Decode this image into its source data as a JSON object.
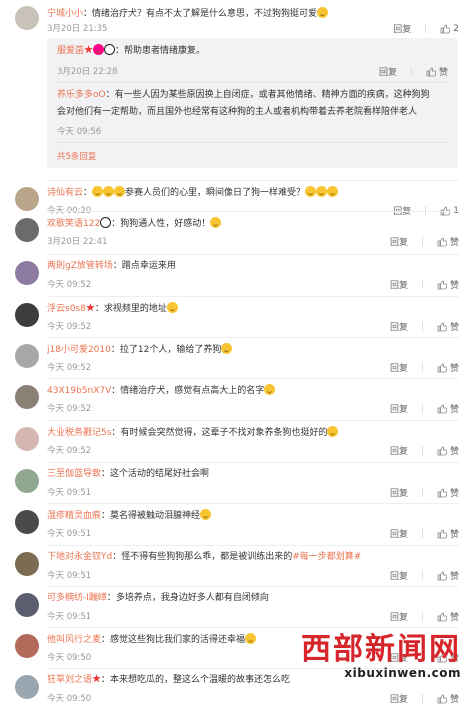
{
  "colors": {
    "nickname": "#eb7350",
    "watermark": "#d7262b",
    "panel": "#f2f2f5"
  },
  "icons": {
    "like": "thumb-up-icon"
  },
  "top_comment": {
    "user": "宁城小小",
    "text": "情绪治疗犬？有点不太了解是什么意思，不过狗狗挺可爱",
    "time": "3月20日 21:35",
    "reply": "回复",
    "likes": "2"
  },
  "replies": [
    {
      "user": "服爱菡",
      "text": "帮助患者情绪康复。",
      "time": "3月20日 22:28",
      "reply": "回复",
      "like": "赞"
    },
    {
      "user": "养乐多多oO",
      "text": "有一些人因为某些原因换上自闭症，或者其他情绪、精神方面的疾病，这种狗狗",
      "text2": "会对他们有一定帮助，而且国外也经常有这种狗的主人或者机构带着去养老院看样陪伴老人",
      "time": "今天 09:56",
      "reply": "回复",
      "like": "赞"
    }
  ],
  "more_replies": "共5条回复",
  "comments": [
    {
      "user": "诗仙有云",
      "text": "参赛人员们的心里，瞬间像日了狗一样难受？",
      "time": "今天 00:20",
      "reply": "回复",
      "likes": "1"
    },
    {
      "user": "欢歌笑语122",
      "text": "狗狗通人性，好感动！",
      "time": "3月20日 22:41",
      "reply": "回复",
      "like": "赞"
    },
    {
      "user": "两則gZ放管转场",
      "text": "蹭点幸运来用",
      "time": "今天 09:52",
      "reply": "回复",
      "like": "赞"
    },
    {
      "user": "浮云s0s8",
      "text": "求视频里的地址",
      "time": "今天 09:52",
      "reply": "回复",
      "like": "赞"
    },
    {
      "user": "j18小可爱2010",
      "text": "拉了12个人，输给了养狗",
      "time": "今天 09:52",
      "reply": "回复",
      "like": "赞"
    },
    {
      "user": "43X19b5nX7V",
      "text": "情绪治疗犬，感觉有点高大上的名字",
      "time": "今天 09:52",
      "reply": "回复",
      "like": "赞"
    },
    {
      "user": "大业税务戳记5s",
      "text": "有时候会突然觉得，这辈子不找对象养条狗也挺好的",
      "time": "今天 09:52",
      "reply": "回复",
      "like": "赞"
    },
    {
      "user": "三至伽蓝导致",
      "text": "这个活动的结尾好社会啊",
      "time": "今天 09:51",
      "reply": "回复",
      "like": "赞"
    },
    {
      "user": "湿疹精灵血痕",
      "text": "莫名得被触动泪腺神经",
      "time": "今天 09:51",
      "reply": "回复",
      "like": "赞"
    },
    {
      "user": "下地对永金钗Yd",
      "text": "怪不得有些狗狗那么乖，都是被训练出来的",
      "tag": "#每一步都划算#",
      "time": "今天 09:51",
      "reply": "回复",
      "like": "赞"
    },
    {
      "user": "可多楠纺-I蹦嶂",
      "text": "多培养点，我身边好多人都有自闭倾向",
      "time": "今天 09:51",
      "reply": "回复",
      "like": "赞"
    },
    {
      "user": "他叫风行之麦",
      "text": "感觉这些狗比我们家的活得还幸福",
      "time": "今天 09:50",
      "reply": "回复",
      "like": "赞"
    },
    {
      "user": "狂草刘之语",
      "text": "本来想吃瓜的，整这么个温暖的故事还怎么吃",
      "time": "今天 09:50",
      "reply": "回复",
      "like": "赞"
    }
  ],
  "watermark": {
    "line1": "西部新闻网",
    "line2": "xibuxinwen.com"
  }
}
